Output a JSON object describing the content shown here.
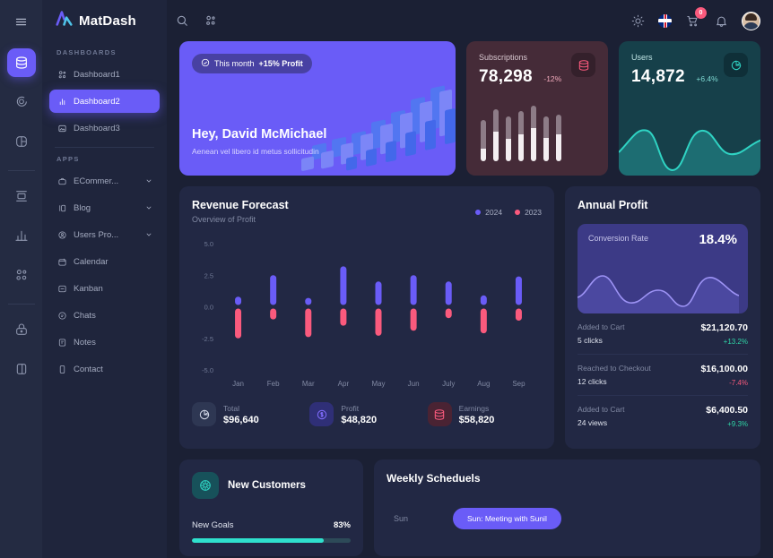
{
  "brand": {
    "name": "MatDash",
    "logo_icon": "matdash-logo-icon"
  },
  "rail": {
    "menu_icon": "hamburger-icon",
    "items": [
      {
        "icon": "database-icon",
        "active": true
      },
      {
        "icon": "chat-bubble-icon",
        "active": false
      },
      {
        "icon": "pie-chart-icon",
        "active": false
      },
      {
        "icon": "browser-window-icon",
        "active": false
      },
      {
        "icon": "bar-chart-icon",
        "active": false
      },
      {
        "icon": "grid-apps-icon",
        "active": false
      },
      {
        "icon": "lock-icon",
        "active": false
      },
      {
        "icon": "sidebar-panel-icon",
        "active": false
      }
    ]
  },
  "sidebar": {
    "dashboards_label": "DASHBOARDS",
    "apps_label": "APPS",
    "dashboards": [
      {
        "label": "Dashboard1",
        "icon": "users-icon",
        "active": false
      },
      {
        "label": "Dashboard2",
        "icon": "bar-chart-icon",
        "active": true
      },
      {
        "label": "Dashboard3",
        "icon": "image-icon",
        "active": false
      }
    ],
    "apps": [
      {
        "label": "ECommer...",
        "icon": "bag-icon",
        "chevron": true
      },
      {
        "label": "Blog",
        "icon": "blog-icon",
        "chevron": true
      },
      {
        "label": "Users Pro...",
        "icon": "user-circle-icon",
        "chevron": true
      },
      {
        "label": "Calendar",
        "icon": "calendar-icon",
        "chevron": false
      },
      {
        "label": "Kanban",
        "icon": "kanban-icon",
        "chevron": false
      },
      {
        "label": "Chats",
        "icon": "chat-icon",
        "chevron": false
      },
      {
        "label": "Notes",
        "icon": "notes-icon",
        "chevron": false
      },
      {
        "label": "Contact",
        "icon": "contact-icon",
        "chevron": false
      }
    ]
  },
  "topbar": {
    "search_icon": "search-icon",
    "apps_icon": "grid-apps-icon",
    "theme_icon": "sun-icon",
    "language_icon": "uk-flag-icon",
    "cart_icon": "shopping-cart-icon",
    "cart_badge": "0",
    "notifications_icon": "bell-icon",
    "avatar": "user-avatar"
  },
  "hero": {
    "pill_check_icon": "check-circle-icon",
    "pill_text": "This month",
    "pill_value": "+15% Profit",
    "title": "Hey, David McMichael",
    "subtitle": "Aenean vel libero id metus sollicitudin"
  },
  "subscriptions": {
    "label": "Subscriptions",
    "value": "78,298",
    "delta": "-12%",
    "icon": "database-icon"
  },
  "users": {
    "label": "Users",
    "value": "14,872",
    "delta": "+6.4%",
    "icon": "pie-chart-icon"
  },
  "revenue": {
    "title": "Revenue Forecast",
    "subtitle": "Overview of Profit",
    "legend": [
      {
        "label": "2024",
        "color": "#6a5cf7"
      },
      {
        "label": "2023",
        "color": "#fa5a7d"
      }
    ],
    "stats": [
      {
        "label": "Total",
        "value": "$96,640",
        "icon": "pie-chart-icon",
        "tone": "grey"
      },
      {
        "label": "Profit",
        "value": "$48,820",
        "icon": "dollar-icon",
        "tone": "indigo"
      },
      {
        "label": "Earnings",
        "value": "$58,820",
        "icon": "database-icon",
        "tone": "red"
      }
    ]
  },
  "chart_data": {
    "type": "bar",
    "title": "Revenue Forecast",
    "subtitle": "Overview of Profit",
    "categories": [
      "Jan",
      "Feb",
      "Mar",
      "Apr",
      "May",
      "Jun",
      "July",
      "Aug",
      "Sep"
    ],
    "series": [
      {
        "name": "2024",
        "color": "#6a5cf7",
        "values": [
          0.8,
          2.5,
          0.7,
          3.2,
          2.0,
          2.5,
          2.0,
          0.9,
          2.4
        ]
      },
      {
        "name": "2023",
        "color": "#fa5a7d",
        "values": [
          -2.5,
          -1.0,
          -2.4,
          -1.5,
          -2.3,
          -1.9,
          -0.9,
          -2.1,
          -1.1
        ]
      }
    ],
    "xlabel": "",
    "ylabel": "",
    "ylim": [
      -5.0,
      5.0
    ],
    "yticks": [
      "5.0",
      "2.5",
      "0.0",
      "-2.5",
      "-5.0"
    ],
    "grid": false,
    "legend_position": "top-right"
  },
  "annual": {
    "title": "Annual Profit",
    "conversion_label": "Conversion Rate",
    "conversion_value": "18.4%",
    "rows": [
      {
        "label": "Added to Cart",
        "sub": "5 clicks",
        "value": "$21,120.70",
        "delta": "+13.2%",
        "direction": "up"
      },
      {
        "label": "Reached to Checkout",
        "sub": "12 clicks",
        "value": "$16,100.00",
        "delta": "-7.4%",
        "direction": "down"
      },
      {
        "label": "Added to Cart",
        "sub": "24 views",
        "value": "$6,400.50",
        "delta": "+9.3%",
        "direction": "up"
      }
    ]
  },
  "new_customers": {
    "title": "New Customers",
    "icon": "customers-icon",
    "goal_label": "New Goals",
    "goal_percent": "83%",
    "goal_value": 83
  },
  "weekly": {
    "title": "Weekly Scheduels",
    "rows": [
      {
        "day": "Sun",
        "event": "Sun: Meeting with Sunil"
      }
    ]
  },
  "colors": {
    "accent": "#6a5cf7",
    "pink": "#fa5a7d",
    "teal": "#2fd3c3",
    "green": "#2fd3a5",
    "page_bg": "#1b2034",
    "card_bg": "#222844"
  }
}
